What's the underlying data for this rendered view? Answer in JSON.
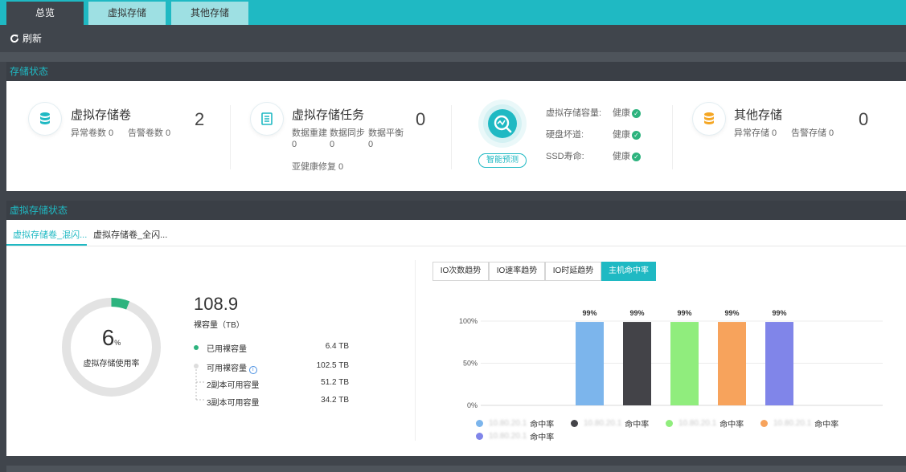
{
  "tabs": [
    {
      "label": "总览",
      "active": true
    },
    {
      "label": "虚拟存储",
      "active": false
    },
    {
      "label": "其他存储",
      "active": false
    }
  ],
  "toolbar": {
    "refresh_label": "刷新"
  },
  "storage_status": {
    "title": "存储状态",
    "volumes": {
      "title": "虚拟存储卷",
      "abnormal": "异常卷数 0",
      "alarm": "告警卷数 0",
      "count": "2"
    },
    "tasks": {
      "title": "虚拟存储任务",
      "c1": "数据重建",
      "c1v": "0",
      "c2": "数据同步",
      "c2v": "0",
      "c3": "数据平衡",
      "c3v": "0",
      "sub_health": "亚健康修复 0",
      "count": "0"
    },
    "predict": {
      "badge": "智能预测",
      "items": [
        {
          "label": "虚拟存储容量:",
          "status": "健康"
        },
        {
          "label": "硬盘坏道:",
          "status": "健康"
        },
        {
          "label": "SSD寿命:",
          "status": "健康"
        }
      ]
    },
    "other": {
      "title": "其他存储",
      "abnormal": "异常存储 0",
      "alarm": "告警存储 0",
      "count": "0"
    }
  },
  "virtual_status": {
    "title": "虚拟存储状态",
    "subtabs": [
      "虚拟存储卷_混闪...",
      "虚拟存储卷_全闪..."
    ],
    "usage_percent": 6,
    "usage_number": "6",
    "usage_unit": "%",
    "usage_label": "虚拟存储使用率",
    "total_capacity": "108.9",
    "total_label": "裸容量（TB）",
    "used": {
      "label": "已用裸容量",
      "value": "6.4 TB"
    },
    "available": {
      "label": "可用裸容量",
      "value": "102.5 TB"
    },
    "replica2": {
      "label": "2副本可用容量",
      "value": "51.2 TB"
    },
    "replica3": {
      "label": "3副本可用容量",
      "value": "34.2 TB"
    },
    "chart_tabs": [
      {
        "label": "IO次数趋势",
        "active": false
      },
      {
        "label": "IO速率趋势",
        "active": false
      },
      {
        "label": "IO时延趋势",
        "active": false
      },
      {
        "label": "主机命中率",
        "active": true
      }
    ]
  },
  "colors": {
    "accent": "#1fb9c3",
    "healthy": "#2db37e",
    "donut_fill": "#2db37e",
    "donut_track": "#e3e3e3"
  },
  "chart_data": {
    "type": "bar",
    "categories": [
      "10.80.20.1",
      "10.80.20.1",
      "10.80.20.1",
      "10.80.20.1",
      "10.80.20.1"
    ],
    "series": [
      {
        "name": "命中率",
        "values": [
          99,
          99,
          99,
          99,
          99
        ]
      }
    ],
    "bar_colors": [
      "#7cb5ec",
      "#434348",
      "#90ed7d",
      "#f7a35c",
      "#8085e9"
    ],
    "data_labels": [
      "99%",
      "99%",
      "99%",
      "99%",
      "99%"
    ],
    "yticks": [
      "0%",
      "50%",
      "100%"
    ],
    "ylim": [
      0,
      100
    ],
    "legend": [
      {
        "ip": "10.80.20.1",
        "text": "命中率"
      },
      {
        "ip": "10.80.20.1",
        "text": "命中率"
      },
      {
        "ip": "10.80.20.1",
        "text": "命中率"
      },
      {
        "ip": "10.80.20.1",
        "text": "命中率"
      },
      {
        "ip": "10.80.20.1",
        "text": "命中率"
      }
    ],
    "legend_position": "bottom"
  }
}
